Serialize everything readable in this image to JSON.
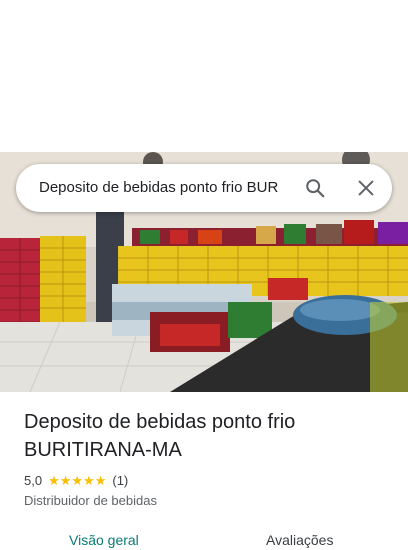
{
  "search": {
    "value": "Deposito de bebidas ponto frio BUR"
  },
  "icons": {
    "search": "search-icon",
    "close": "close-icon"
  },
  "place": {
    "title": "Deposito de bebidas ponto frio BURITIRANA-MA",
    "rating": "5,0",
    "stars": "★★★★★",
    "review_count": "(1)",
    "category": "Distribuidor de bebidas"
  },
  "tabs": [
    {
      "label": "Visão geral",
      "active": true
    },
    {
      "label": "Avaliações",
      "active": false
    }
  ],
  "colors": {
    "star": "#fbbc04",
    "active_tab": "#0b7a75"
  }
}
